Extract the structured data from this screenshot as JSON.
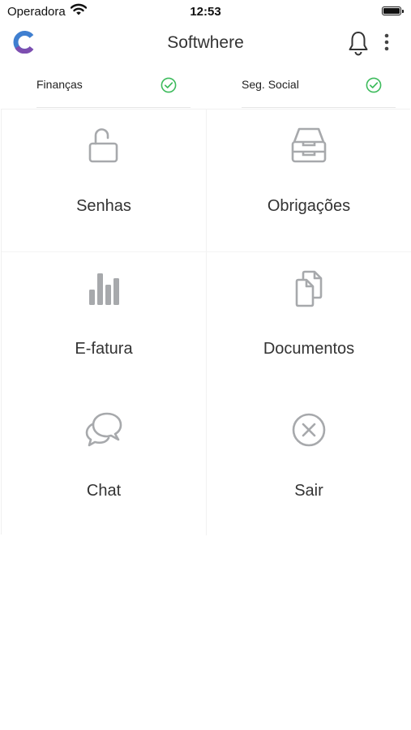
{
  "status_bar": {
    "carrier": "Operadora",
    "time": "12:53"
  },
  "header": {
    "title": "Softwhere"
  },
  "status_tabs": [
    {
      "label": "Finanças",
      "state": "ok"
    },
    {
      "label": "Seg. Social",
      "state": "ok"
    }
  ],
  "tiles": [
    {
      "label": "Senhas",
      "icon": "unlocked-padlock-icon"
    },
    {
      "label": "Obrigações",
      "icon": "inbox-tray-icon"
    },
    {
      "label": "E-fatura",
      "icon": "bar-chart-icon"
    },
    {
      "label": "Documentos",
      "icon": "documents-icon"
    },
    {
      "label": "Chat",
      "icon": "chat-bubbles-icon"
    },
    {
      "label": "Sair",
      "icon": "close-circle-icon"
    }
  ],
  "colors": {
    "icon_gray": "#a7a9ac",
    "check_green": "#3dbb5c",
    "logo_blue": "#3f7fd0",
    "logo_purple": "#7d4eb0"
  }
}
